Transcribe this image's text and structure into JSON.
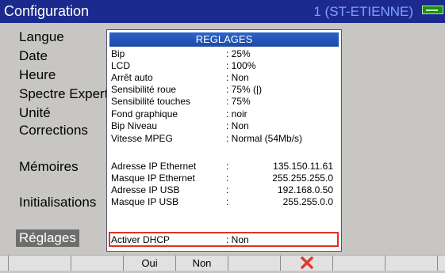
{
  "titlebar": {
    "title": "Configuration",
    "site": "1 (ST-ETIENNE)"
  },
  "menu": {
    "items": [
      {
        "label": "Langue"
      },
      {
        "label": "Date"
      },
      {
        "label": "Heure"
      },
      {
        "label": "Spectre Expert"
      },
      {
        "label": "Unité"
      },
      {
        "label": "Corrections"
      },
      {
        "label": "Mémoires"
      },
      {
        "label": "Initialisations"
      },
      {
        "label": "Réglages"
      }
    ],
    "active_item": "Réglages"
  },
  "panel": {
    "title": "REGLAGES",
    "settings": [
      {
        "label": "Bip",
        "value": ": 25%"
      },
      {
        "label": "LCD",
        "value": ": 100%"
      },
      {
        "label": "Arrêt auto",
        "value": ": Non"
      },
      {
        "label": "Sensibilité roue",
        "value": ":  75% (|)"
      },
      {
        "label": "Sensibilité touches",
        "value": ":  75%"
      },
      {
        "label": "Fond graphique",
        "value": ": noir"
      },
      {
        "label": "Bip Niveau",
        "value": ": Non"
      },
      {
        "label": "Vitesse MPEG",
        "value": ": Normal (54Mb/s)"
      }
    ],
    "network": [
      {
        "label": "Adresse IP Ethernet",
        "sep": ":",
        "value": "135.150.11.61"
      },
      {
        "label": "Masque IP Ethernet",
        "sep": ":",
        "value": "255.255.255.0"
      },
      {
        "label": "Adresse IP USB",
        "sep": ":",
        "value": "192.168.0.50"
      },
      {
        "label": "Masque IP USB",
        "sep": ":",
        "value": "255.255.0.0"
      }
    ],
    "dhcp": {
      "label": "Activer DHCP",
      "value": ": Non"
    }
  },
  "footer": {
    "keys": [
      "",
      "",
      "Oui",
      "Non",
      "",
      "",
      "",
      "",
      ""
    ],
    "close_icon": "close-icon"
  },
  "colors": {
    "titlebar": "#1c2a8e",
    "panel_header": "#2b63c8",
    "highlight_border": "#e0302a",
    "active_menu_bg": "#6d6d6d",
    "battery": "#1f8e14"
  }
}
